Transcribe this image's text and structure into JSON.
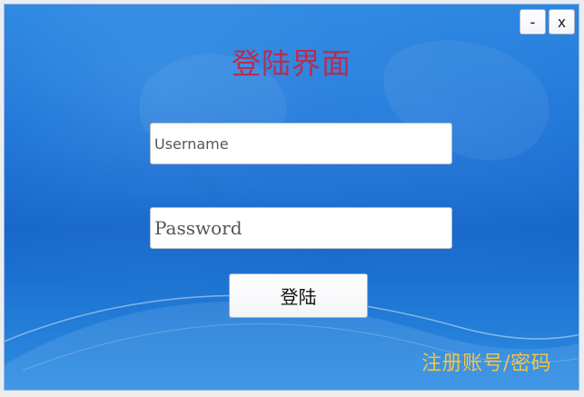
{
  "window": {
    "minimize_label": "-",
    "close_label": "x"
  },
  "login": {
    "title": "登陆界面",
    "username_placeholder": "Username",
    "password_placeholder": "Password",
    "submit_label": "登陆",
    "register_label": "注册账号/密码"
  },
  "colors": {
    "title": "#b92d4f",
    "register_link": "#f2c449",
    "background_primary": "#1d74d6"
  }
}
